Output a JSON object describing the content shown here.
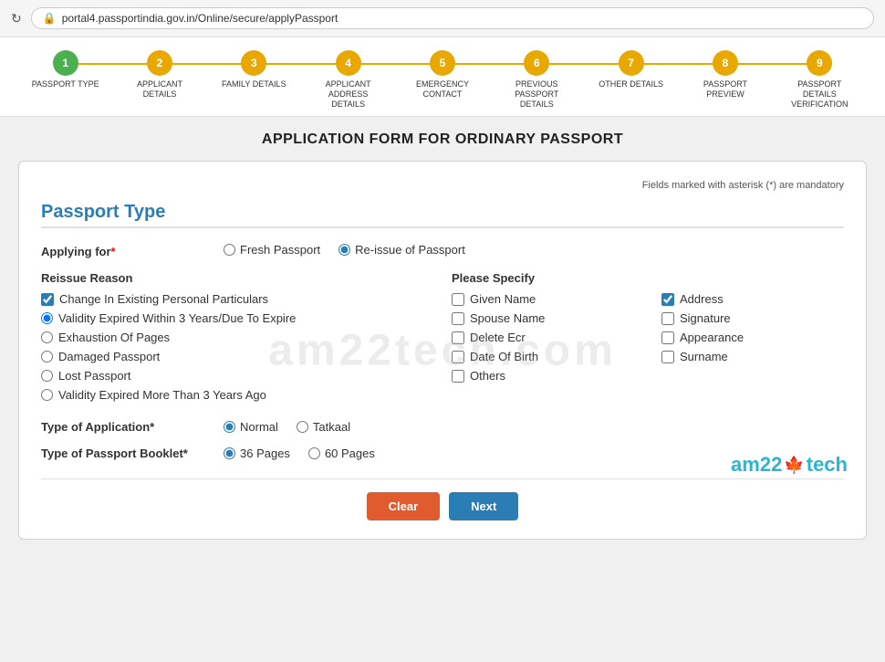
{
  "browser": {
    "url": "portal4.passportindia.gov.in/Online/secure/applyPassport"
  },
  "steps": [
    {
      "number": "1",
      "label": "PASSPORT TYPE",
      "state": "completed"
    },
    {
      "number": "2",
      "label": "APPLICANT DETAILS",
      "state": "active"
    },
    {
      "number": "3",
      "label": "FAMILY DETAILS",
      "state": "active"
    },
    {
      "number": "4",
      "label": "APPLICANT ADDRESS DETAILS",
      "state": "active"
    },
    {
      "number": "5",
      "label": "EMERGENCY CONTACT",
      "state": "active"
    },
    {
      "number": "6",
      "label": "PREVIOUS PASSPORT DETAILS",
      "state": "active"
    },
    {
      "number": "7",
      "label": "OTHER DETAILS",
      "state": "active"
    },
    {
      "number": "8",
      "label": "PASSPORT PREVIEW",
      "state": "active"
    },
    {
      "number": "9",
      "label": "PASSPORT DETAILS VERIFICATION",
      "state": "active"
    }
  ],
  "page": {
    "title": "APPLICATION FORM FOR ORDINARY PASSPORT"
  },
  "form": {
    "mandatory_note": "Fields marked with asterisk (*) are mandatory",
    "section_title": "Passport Type",
    "applying_for_label": "Applying for",
    "applying_for_options": [
      {
        "value": "fresh",
        "label": "Fresh Passport",
        "checked": false
      },
      {
        "value": "reissue",
        "label": "Re-issue of Passport",
        "checked": true
      }
    ],
    "reissue_reason_label": "Reissue Reason",
    "reissue_reasons": [
      {
        "value": "change_personal",
        "label": "Change In Existing Personal Particulars",
        "type": "checkbox",
        "checked": true
      },
      {
        "value": "validity_expired",
        "label": "Validity Expired Within 3 Years/Due To Expire",
        "type": "radio",
        "checked": true
      },
      {
        "value": "exhaustion",
        "label": "Exhaustion Of Pages",
        "type": "radio",
        "checked": false
      },
      {
        "value": "damaged",
        "label": "Damaged Passport",
        "type": "radio",
        "checked": false
      },
      {
        "value": "lost",
        "label": "Lost Passport",
        "type": "radio",
        "checked": false
      },
      {
        "value": "validity_3years",
        "label": "Validity Expired More Than 3 Years Ago",
        "type": "radio",
        "checked": false
      }
    ],
    "please_specify_label": "Please Specify",
    "specify_col1": [
      {
        "value": "given_name",
        "label": "Given Name",
        "checked": false
      },
      {
        "value": "spouse_name",
        "label": "Spouse Name",
        "checked": false
      },
      {
        "value": "delete_ecr",
        "label": "Delete Ecr",
        "checked": false
      },
      {
        "value": "date_of_birth",
        "label": "Date Of Birth",
        "checked": false
      },
      {
        "value": "others",
        "label": "Others",
        "checked": false
      }
    ],
    "specify_col2": [
      {
        "value": "address",
        "label": "Address",
        "checked": true
      },
      {
        "value": "signature",
        "label": "Signature",
        "checked": false
      },
      {
        "value": "appearance",
        "label": "Appearance",
        "checked": false
      },
      {
        "value": "surname",
        "label": "Surname",
        "checked": false
      }
    ],
    "type_of_application_label": "Type of Application",
    "type_of_application_options": [
      {
        "value": "normal",
        "label": "Normal",
        "checked": true
      },
      {
        "value": "tatkaal",
        "label": "Tatkaal",
        "checked": false
      }
    ],
    "type_of_booklet_label": "Type of Passport Booklet",
    "type_of_booklet_options": [
      {
        "value": "36",
        "label": "36 Pages",
        "checked": true
      },
      {
        "value": "60",
        "label": "60 Pages",
        "checked": false
      }
    ],
    "clear_button": "Clear",
    "next_button": "Next"
  }
}
